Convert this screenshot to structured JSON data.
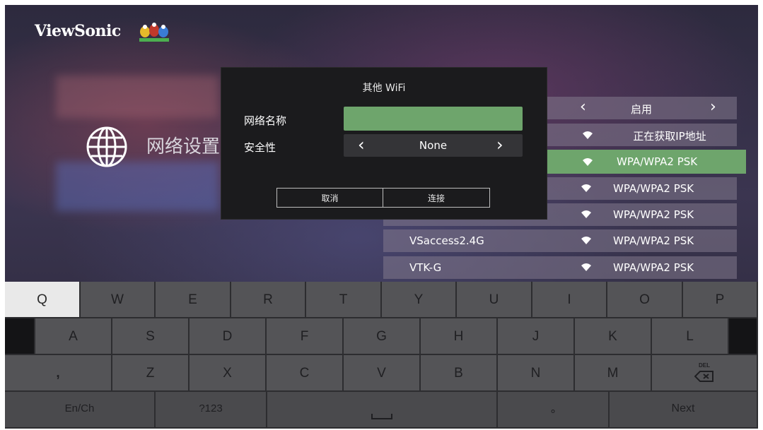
{
  "brand": {
    "name": "ViewSonic"
  },
  "background": {
    "title": "网络设置"
  },
  "network_list": {
    "top_toggle": "启用",
    "status": "正在获取IP地址",
    "highlighted_security": "WPA/WPA2 PSK",
    "rows": [
      {
        "ssid": "",
        "security": "WPA/WPA2 PSK"
      },
      {
        "ssid": "",
        "security": "WPA/WPA2 PSK"
      },
      {
        "ssid": "VSaccess2.4G",
        "security": "WPA/WPA2 PSK"
      },
      {
        "ssid": "VTK-G",
        "security": "WPA/WPA2 PSK"
      }
    ]
  },
  "dialog": {
    "title": "其他 WiFi",
    "name_label": "网络名称",
    "name_value": "",
    "security_label": "安全性",
    "security_value": "None",
    "cancel": "取消",
    "connect": "连接"
  },
  "keyboard": {
    "row1": [
      "Q",
      "W",
      "E",
      "R",
      "T",
      "Y",
      "U",
      "I",
      "O",
      "P"
    ],
    "row2": [
      "A",
      "S",
      "D",
      "F",
      "G",
      "H",
      "J",
      "K",
      "L"
    ],
    "row3": [
      ",",
      "Z",
      "X",
      "C",
      "V",
      "B",
      "N",
      "M"
    ],
    "delete_label": "DEL",
    "lang_switch": "En/Ch",
    "symbols": "?123",
    "period": "∘",
    "next": "Next",
    "selected_key": "Q",
    "colors": {
      "highlight": "#6ea56c",
      "key": "#545457",
      "selected_key": "#e9e9e9"
    }
  }
}
